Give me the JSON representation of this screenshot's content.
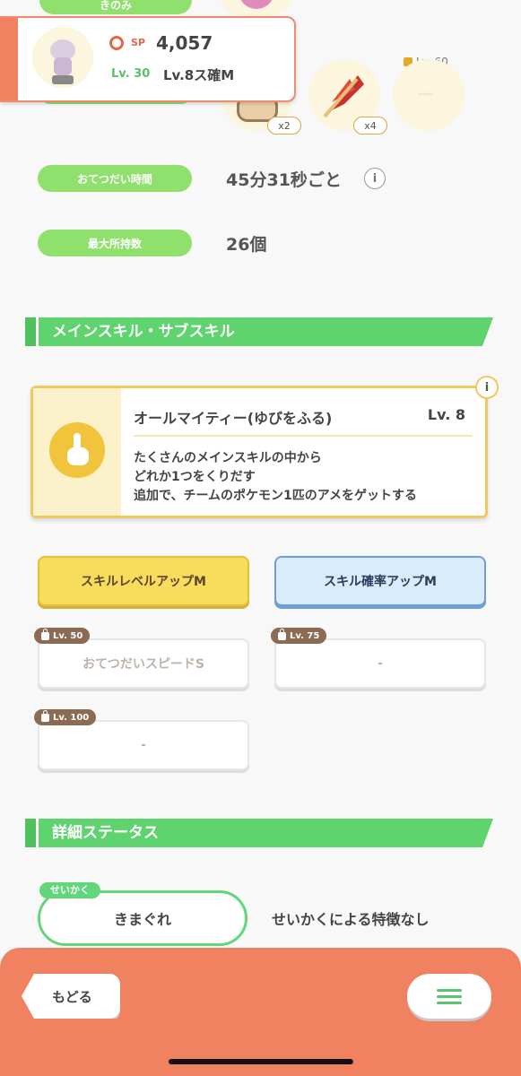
{
  "top": {
    "cut_label": "きのみ"
  },
  "pokemon_card": {
    "sp_label": "SP",
    "sp_value": "4,057",
    "level": "Lv. 30",
    "subskill": "Lv.8ス確M"
  },
  "ingredients": {
    "slot1_count": "x2",
    "slot2_count": "x4",
    "slot3_lock": "Lv. 60",
    "slot3_value": "—"
  },
  "stats": {
    "help_time_label": "おてつだい時間",
    "help_time_value": "45分31秒ごと",
    "max_inventory_label": "最大所持数",
    "max_inventory_value": "26個"
  },
  "skills_section": {
    "title": "メインスキル・サブスキル",
    "main_skill": {
      "name": "オールマイティー(ゆびをふる)",
      "level": "Lv. 8",
      "description": [
        "たくさんのメインスキルの中から",
        "どれか1つをくりだす",
        "追加で、チームのポケモン1匹のアメをゲットする"
      ]
    },
    "subskills": [
      {
        "label": "スキルレベルアップM"
      },
      {
        "label": "スキル確率アップM"
      },
      {
        "lock": "Lv. 50",
        "label": "おてつだいスピードS"
      },
      {
        "lock": "Lv. 75",
        "label": "-"
      },
      {
        "lock": "Lv. 100",
        "label": "-"
      }
    ]
  },
  "details_section": {
    "title": "詳細ステータス",
    "nature_tag": "せいかく",
    "nature_value": "きまぐれ",
    "nature_effect": "せいかくによる特徴なし"
  },
  "footer": {
    "back_label": "もどる"
  },
  "colors": {
    "green_accent": "#5fd36e",
    "footer_orange": "#f08262",
    "gold_button": "#f7db55",
    "blue_button": "#d6ecfb"
  }
}
